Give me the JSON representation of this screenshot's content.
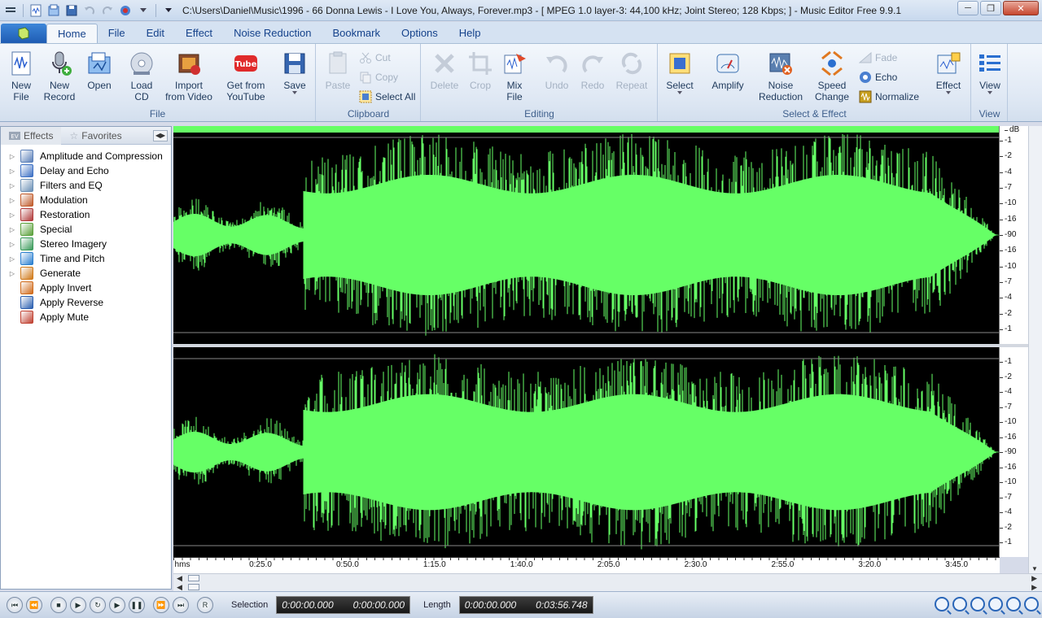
{
  "window": {
    "title": "C:\\Users\\Daniel\\Music\\1996 - 66 Donna Lewis - I Love You, Always, Forever.mp3 - [ MPEG 1.0 layer-3: 44,100 kHz; Joint Stereo; 128 Kbps;  ] - Music Editor Free 9.9.1"
  },
  "tabs": [
    "Home",
    "File",
    "Edit",
    "Effect",
    "Noise Reduction",
    "Bookmark",
    "Options",
    "Help"
  ],
  "ribbon": {
    "file_group": {
      "label": "File",
      "new_file": "New\nFile",
      "new_record": "New\nRecord",
      "open": "Open",
      "load_cd": "Load\nCD",
      "import_video": "Import\nfrom Video",
      "youtube": "Get from\nYouTube",
      "save": "Save"
    },
    "clipboard_group": {
      "label": "Clipboard",
      "paste": "Paste",
      "cut": "Cut",
      "copy": "Copy",
      "select_all": "Select All"
    },
    "editing_group": {
      "label": "Editing",
      "delete": "Delete",
      "crop": "Crop",
      "mix_file": "Mix\nFile",
      "undo": "Undo",
      "redo": "Redo",
      "repeat": "Repeat"
    },
    "select_effect_group": {
      "label": "Select & Effect",
      "select": "Select",
      "amplify": "Amplify",
      "noise_reduction": "Noise\nReduction",
      "speed_change": "Speed\nChange",
      "fade": "Fade",
      "echo": "Echo",
      "normalize": "Normalize",
      "effect": "Effect"
    },
    "view_group": {
      "label": "View",
      "view": "View"
    }
  },
  "panel": {
    "tabs": [
      "Effects",
      "Favorites"
    ],
    "items": [
      {
        "label": "Amplitude and Compression",
        "expandable": true,
        "color": "#5a7fb8"
      },
      {
        "label": "Delay and Echo",
        "expandable": true,
        "color": "#3b6fc4"
      },
      {
        "label": "Filters and EQ",
        "expandable": true,
        "color": "#6a8fb5"
      },
      {
        "label": "Modulation",
        "expandable": true,
        "color": "#c05a2a"
      },
      {
        "label": "Restoration",
        "expandable": true,
        "color": "#b03a3a"
      },
      {
        "label": "Special",
        "expandable": true,
        "color": "#5aa03a"
      },
      {
        "label": "Stereo Imagery",
        "expandable": true,
        "color": "#3a9a5a"
      },
      {
        "label": "Time and Pitch",
        "expandable": true,
        "color": "#2a7fd0"
      },
      {
        "label": "Generate",
        "expandable": true,
        "color": "#d07a1a"
      },
      {
        "label": "Apply Invert",
        "expandable": false,
        "color": "#d06a1a"
      },
      {
        "label": "Apply Reverse",
        "expandable": false,
        "color": "#2a5fb0"
      },
      {
        "label": "Apply Mute",
        "expandable": false,
        "color": "#c04030"
      }
    ]
  },
  "waveform": {
    "color": "#66ff66",
    "db_unit": "dB",
    "db_ticks": [
      "-1",
      "-2",
      "-4",
      "-7",
      "-10",
      "-16",
      "-90",
      "-16",
      "-10",
      "-7",
      "-4",
      "-2",
      "-1"
    ]
  },
  "timeline": {
    "unit": "hms",
    "ticks": [
      "0:25.0",
      "0:50.0",
      "1:15.0",
      "1:40.0",
      "2:05.0",
      "2:30.0",
      "2:55.0",
      "3:20.0",
      "3:45.0"
    ]
  },
  "transport": {
    "selection_label": "Selection",
    "selection_start": "0:00:00.000",
    "selection_end": "0:00:00.000",
    "length_label": "Length",
    "length_start": "0:00:00.000",
    "length_total": "0:03:56.748",
    "record_symbol": "R"
  }
}
